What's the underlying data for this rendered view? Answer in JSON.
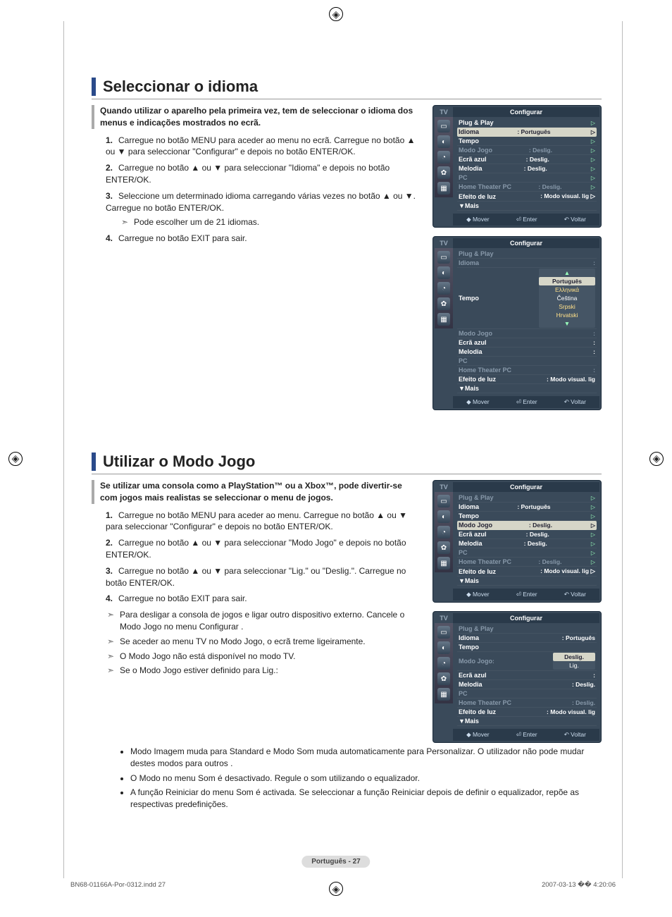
{
  "section1": {
    "title": "Seleccionar o idioma",
    "intro": "Quando utilizar o aparelho pela primeira vez, tem de seleccionar o idioma dos menus e indicações mostrados no ecrã.",
    "steps": {
      "s1": "Carregue no botão MENU para aceder ao menu no ecrã. Carregue no botão ▲ ou ▼ para seleccionar \"Configurar\" e depois no botão ENTER/OK.",
      "s2": "Carregue no botão ▲ ou ▼ para seleccionar \"Idioma\" e depois no botão ENTER/OK.",
      "s3": "Seleccione um determinado idioma carregando várias vezes no botão ▲ ou ▼. Carregue no botão ENTER/OK.",
      "s3note": "Pode escolher um de 21 idiomas.",
      "s4": "Carregue no botão EXIT para sair."
    }
  },
  "section2": {
    "title": "Utilizar o Modo Jogo",
    "intro": "Se utilizar uma consola como a PlayStation™ ou a Xbox™, pode divertir-se com jogos mais realistas se seleccionar o menu de jogos.",
    "steps": {
      "s1": "Carregue no botão MENU para aceder ao menu. Carregue no botão ▲ ou ▼ para seleccionar \"Configurar\" e depois no botão ENTER/OK.",
      "s2": "Carregue no botão ▲ ou ▼ para seleccionar \"Modo Jogo\" e depois no botão ENTER/OK.",
      "s3": "Carregue no botão ▲ ou ▼ para seleccionar \"Lig.\" ou \"Deslig.\". Carregue no botão ENTER/OK.",
      "s4": "Carregue no botão EXIT para sair."
    },
    "notes": {
      "n1": "Para desligar a consola de jogos e ligar outro dispositivo externo. Cancele o Modo Jogo no menu Configurar .",
      "n2": "Se aceder ao menu TV no Modo Jogo, o ecrã treme ligeiramente.",
      "n3": "O Modo Jogo não está disponível no modo TV.",
      "n4": "Se o Modo Jogo estiver definido para Lig.:"
    },
    "bullets": {
      "b1": "Modo Imagem muda para Standard e Modo Som muda automaticamente para Personalizar. O utilizador não pode mudar destes modos para outros .",
      "b2": "O Modo no menu Som é desactivado. Regule o som utilizando o equalizador.",
      "b3": "A função Reiniciar do menu Som é activada. Se seleccionar a função Reiniciar depois de definir o equalizador, repõe as respectivas predefinições."
    }
  },
  "osd": {
    "tv": "TV",
    "title": "Configurar",
    "items": {
      "plugplay": "Plug & Play",
      "idioma": "Idioma",
      "tempo": "Tempo",
      "modojogo": "Modo Jogo",
      "ecra": "Ecrã azul",
      "melodia": "Melodia",
      "pc": "PC",
      "htpc": "Home Theater PC",
      "efeito": "Efeito de luz",
      "mais": "▼Mais"
    },
    "vals": {
      "portugues": ": Português",
      "deslig": ": Deslig.",
      "modovislig": ": Modo visual. lig",
      "modovisliga": ": Modo visual. lig ▷",
      "lig": "Lig."
    },
    "dropdown": {
      "pt": "Português",
      "el": "Eλληνικά",
      "cs": "Čeština",
      "sr": "Srpski",
      "hr": "Hrvatski"
    },
    "dropdown2": {
      "deslig": "Deslig.",
      "lig": "Lig."
    },
    "foot": {
      "mover": "Mover",
      "enter": "Enter",
      "voltar": "Voltar"
    }
  },
  "page_badge": "Português - 27",
  "footer": {
    "left": "BN68-01166A-Por-0312.indd   27",
    "right": "2007-03-13   �� 4:20:06"
  }
}
